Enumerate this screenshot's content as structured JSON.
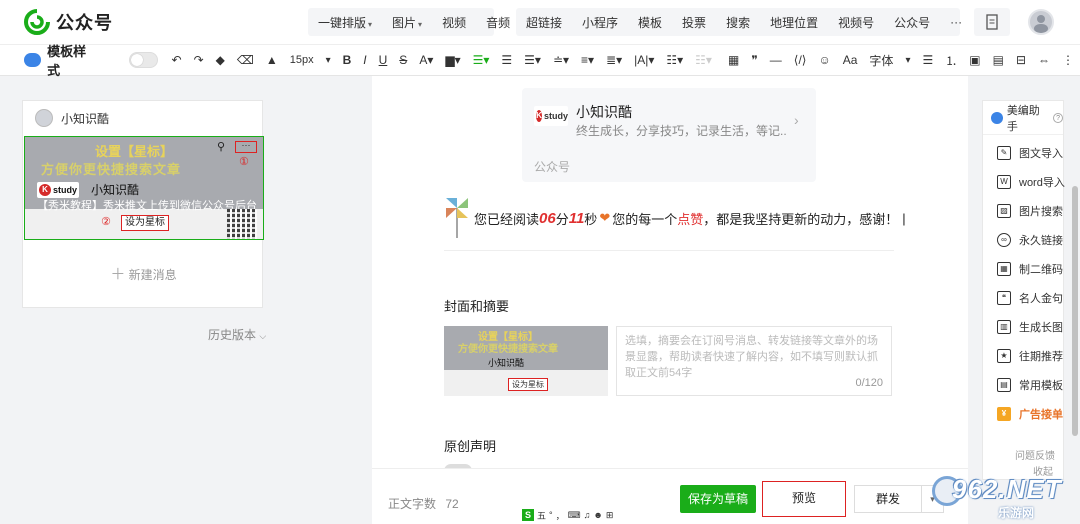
{
  "app": {
    "name": "公众号"
  },
  "topmenu": {
    "group1": [
      "一键排版",
      "图片",
      "视频",
      "音频"
    ],
    "group2": [
      "超链接",
      "小程序",
      "模板",
      "投票",
      "搜索",
      "地理位置",
      "视频号",
      "公众号",
      "···"
    ]
  },
  "toolbar": {
    "template_label": "模板样式",
    "font_size": "15px",
    "font_label": "字体"
  },
  "left": {
    "account_name": "小知识酷",
    "thumb": {
      "line1": "设置【星标】",
      "line2": "方便你更快捷搜索文章",
      "brand": "study",
      "brand_name": "小知识酷",
      "caption": "【秀米教程】秀米推文上传到微信公众号后台",
      "star_button": "设为星标",
      "n1": "①",
      "n2": "②",
      "dots": "···"
    },
    "new_message": "新建消息",
    "history": "历史版本"
  },
  "editor": {
    "account_card": {
      "name": "小知识酷",
      "desc": "终生成长，分享技巧，记录生活，等记...",
      "footer": "公众号"
    },
    "read_line": {
      "prefix": "您已经阅读",
      "minutes": "06",
      "min_unit": "分",
      "seconds": "11",
      "sec_unit": "秒",
      "mid": "您的每一个",
      "like": "点赞",
      "suffix": "，都是我坚持更新的动力，感谢！"
    },
    "cover_section_title": "封面和摘要",
    "summary_placeholder": "选填，摘要会在订阅号消息、转发链接等文章外的场景显露，帮助读者快速了解内容，如不填写则默认抓取正文前54字",
    "summary_count": "0/120",
    "original_section_title": "原创声明"
  },
  "bottom": {
    "word_count_label": "正文字数",
    "word_count": "72",
    "save_draft": "保存为草稿",
    "preview": "预览",
    "mass_send": "群发"
  },
  "ime": {
    "items": [
      "五",
      "°",
      "，"
    ]
  },
  "right": {
    "title": "美编助手",
    "items": [
      "图文导入",
      "word导入",
      "图片搜索",
      "永久链接",
      "制二维码",
      "名人金句",
      "生成长图",
      "往期推荐",
      "常用模板",
      "广告接单"
    ],
    "feedback": "问题反馈",
    "collapse": "收起"
  },
  "watermark": {
    "big": "962.NET",
    "small": "乐游网"
  },
  "colors": {
    "brand_green": "#1aad19",
    "accent_red": "#e03030",
    "highlight_border": "#dd2222"
  }
}
